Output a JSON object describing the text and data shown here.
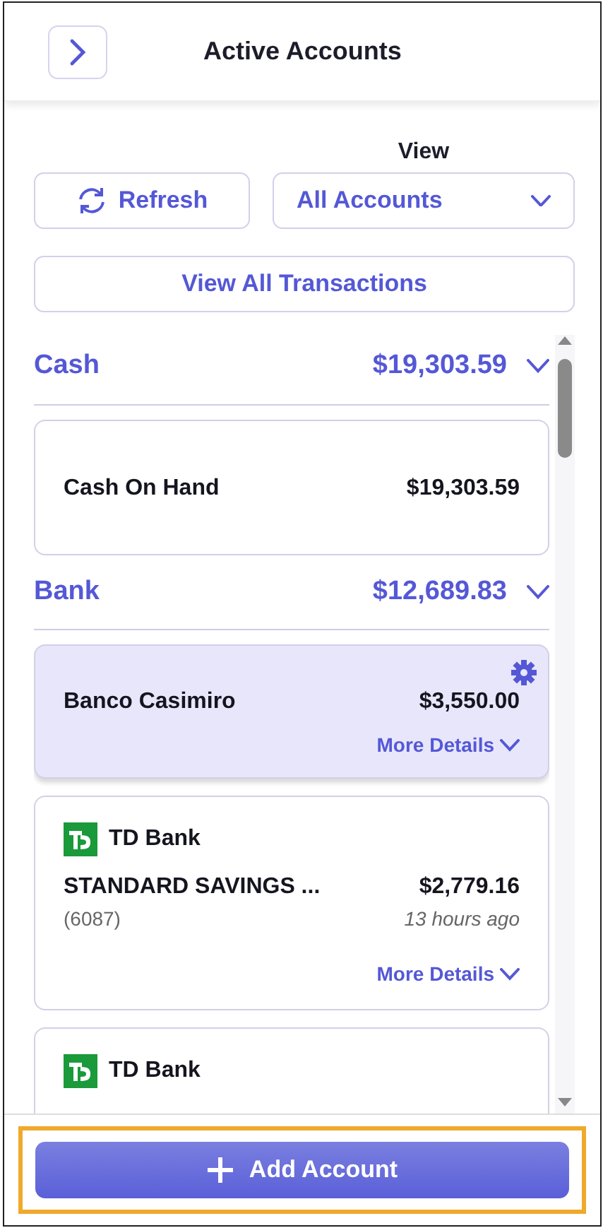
{
  "header": {
    "title": "Active Accounts"
  },
  "controls": {
    "view_label": "View",
    "refresh": "Refresh",
    "view_select": "All Accounts",
    "all_transactions": "View All Transactions"
  },
  "groups": [
    {
      "name": "Cash",
      "total": "$19,303.59",
      "expanded": true,
      "accounts": [
        {
          "kind": "plain",
          "name": "Cash On Hand",
          "balance": "$19,303.59",
          "selected": false
        }
      ]
    },
    {
      "name": "Bank",
      "total": "$12,689.83",
      "expanded": true,
      "accounts": [
        {
          "kind": "manual",
          "name": "Banco Casimiro",
          "balance": "$3,550.00",
          "more": "More Details",
          "selected": true
        },
        {
          "kind": "linked",
          "institution": "TD Bank",
          "name": "STANDARD SAVINGS ...",
          "number": "(6087)",
          "balance": "$2,779.16",
          "updated": "13 hours ago",
          "more": "More Details",
          "selected": false
        },
        {
          "kind": "linked",
          "institution": "TD Bank",
          "selected": false
        }
      ]
    }
  ],
  "add_button": "Add Account"
}
